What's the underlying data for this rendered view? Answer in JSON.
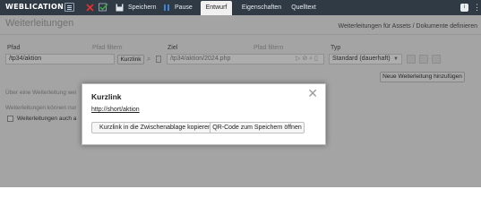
{
  "app": {
    "logo_text": "WEBLICATION"
  },
  "toolbar": {
    "save_label": "Speichern",
    "pause_label": "Pause",
    "tabs": [
      {
        "label": "Entwurf",
        "active": true
      },
      {
        "label": "Eigenschaften",
        "active": false
      },
      {
        "label": "Quelltext",
        "active": false
      }
    ],
    "help_icon": "info-icon",
    "more_icon": "more-vertical-icon"
  },
  "page": {
    "title": "Weiterleitungen",
    "description": "Weiterleitungen für Assets / Dokumente definieren"
  },
  "columns": {
    "path_label": "Pfad",
    "path_filter_label": "Pfad filtern",
    "target_label": "Ziel",
    "target_filter_label": "Pfad filtern",
    "type_label": "Typ"
  },
  "row": {
    "path_value": "/tp34/aktion",
    "shortlink_button": "Kurzlink",
    "target_value": "/tp34/aktion/2024.php",
    "type_value": "Standard (dauerhaft)"
  },
  "add_button": "Neue Weiterleitung hinzufügen",
  "background_text": {
    "line1": "Über eine Weiterleitung wei",
    "line2": "Weiterleitungen können nur",
    "checkbox_label": "Weiterleitungen auch a"
  },
  "modal": {
    "title": "Kurzlink",
    "link": "http://short/aktion",
    "copy_button": "Kurzlink in die Zwischenablage kopieren",
    "qr_button": "QR-Code zum Speichern öffnen"
  },
  "colors": {
    "topbar": "#2f3a45",
    "content_bg": "#f2f2f2",
    "close_red": "#e03030",
    "check_green": "#3aa845",
    "pause_blue": "#3f82d6"
  }
}
